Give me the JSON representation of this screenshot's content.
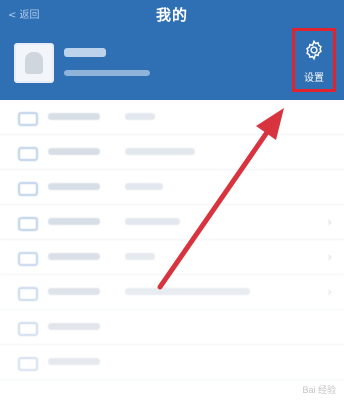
{
  "header": {
    "title": "我的",
    "back_label": "< 返回",
    "settings_label": "设置",
    "accent_color": "#2f6fb4",
    "highlight_color": "#e0242e"
  },
  "profile": {
    "avatar_icon": "user-avatar-icon"
  },
  "list": {
    "items": [
      {
        "icon": "card-icon",
        "value_width": 30
      },
      {
        "icon": "card-icon",
        "value_width": 70
      },
      {
        "icon": "card-icon",
        "value_width": 38
      },
      {
        "icon": "phone-icon",
        "value_width": 55
      },
      {
        "icon": "card-icon",
        "value_width": 30
      },
      {
        "icon": "mail-icon",
        "value_width": 125
      },
      {
        "icon": "card-icon",
        "value_width": 0
      },
      {
        "icon": "card-icon",
        "value_width": 0
      }
    ]
  },
  "annotation": {
    "arrow_color": "#d8343f",
    "watermark": "Bai 经验"
  }
}
